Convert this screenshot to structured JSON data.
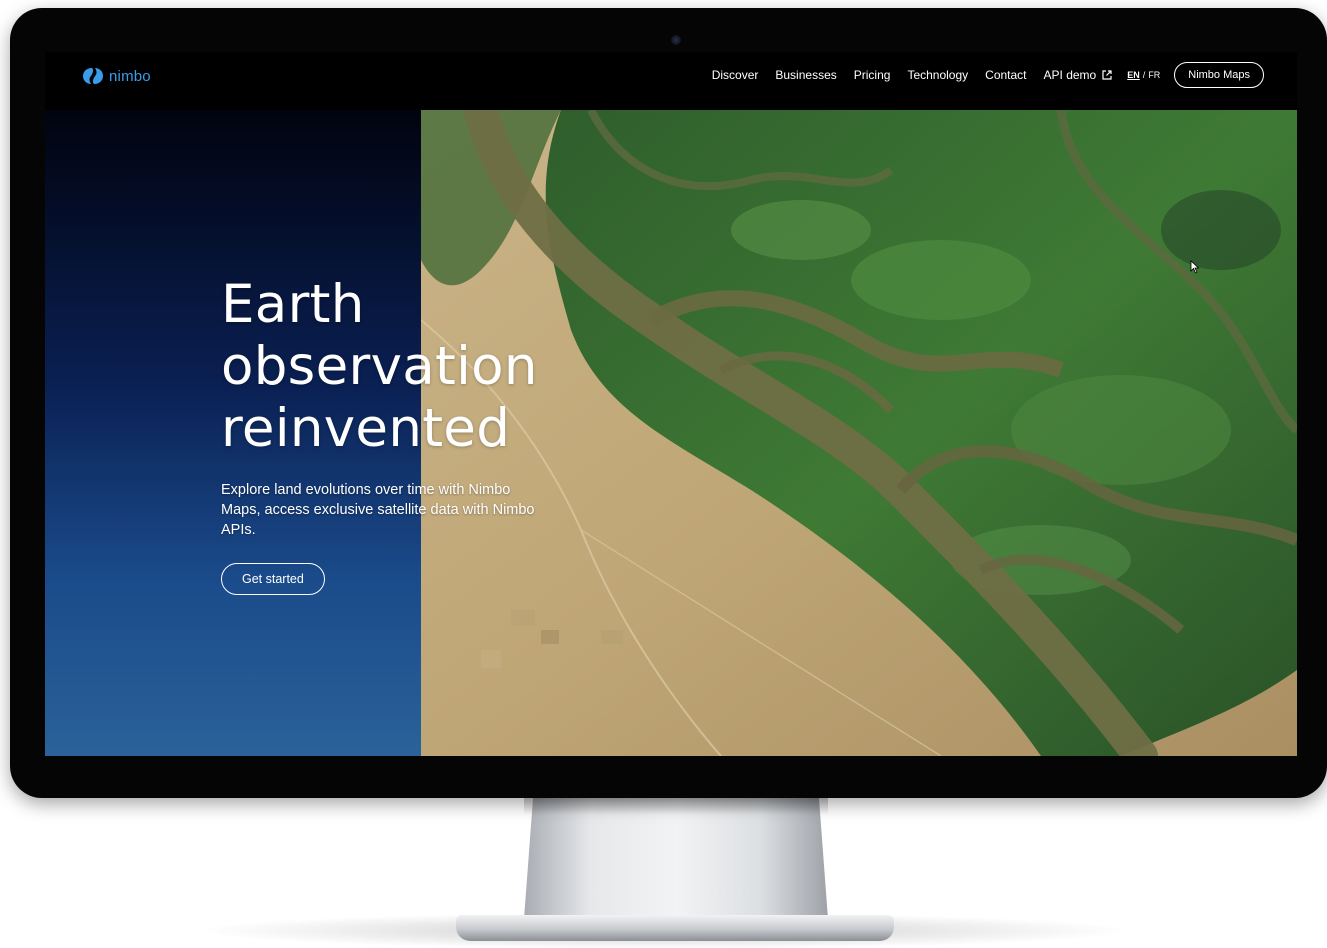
{
  "brand": {
    "name": "nimbo"
  },
  "nav": {
    "items": [
      "Discover",
      "Businesses",
      "Pricing",
      "Technology",
      "Contact"
    ],
    "api_demo": "API demo",
    "lang_en": "EN",
    "lang_sep": "/",
    "lang_fr": "FR",
    "maps_button": "Nimbo Maps"
  },
  "hero": {
    "headline": [
      "Earth",
      "observation",
      "reinvented"
    ],
    "subcopy": "Explore land evolutions over time with Nimbo Maps, access exclusive satellite data with Nimbo APIs.",
    "cta": "Get started"
  },
  "colors": {
    "brand_blue": "#3a9ce8",
    "screen_black": "#000000",
    "gradient_top": "#01030f",
    "gradient_bottom": "#2a6299"
  },
  "icons": {
    "brand": "nimbo-logo-icon",
    "external": "external-link-icon",
    "cursor": "mouse-cursor-icon"
  }
}
